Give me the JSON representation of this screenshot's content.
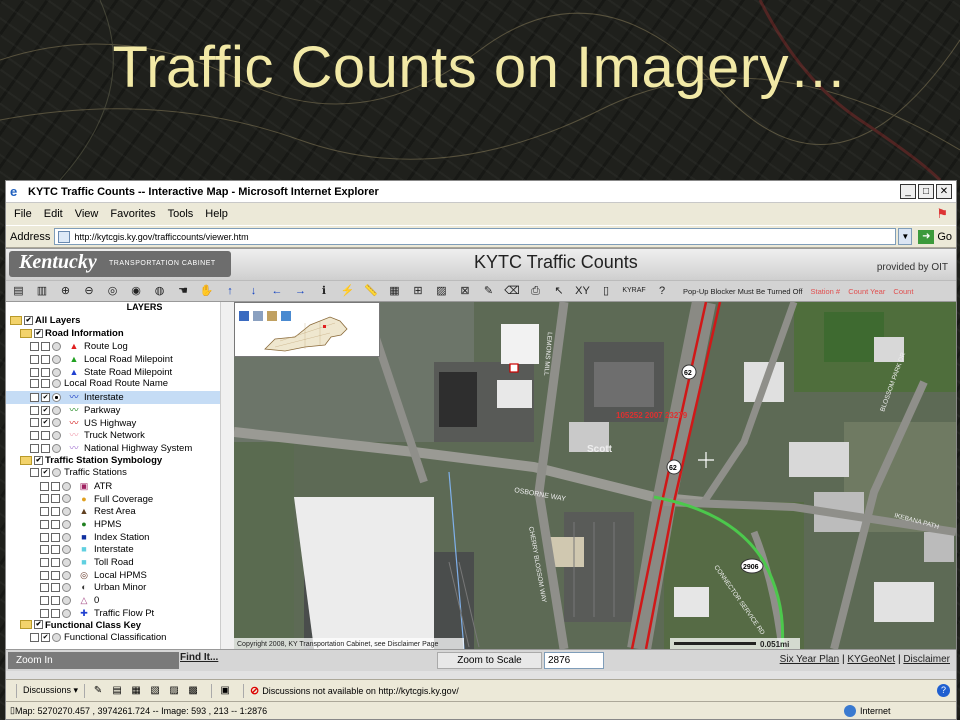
{
  "slide": {
    "title": "Traffic Counts on Imagery…"
  },
  "browser": {
    "title": "KYTC Traffic Counts -- Interactive Map - Microsoft Internet Explorer",
    "menu": [
      "File",
      "Edit",
      "View",
      "Favorites",
      "Tools",
      "Help"
    ],
    "address_label": "Address",
    "url": "http://kytcgis.ky.gov/trafficcounts/viewer.htm",
    "go_label": "Go"
  },
  "app": {
    "logo_text": "Kentucky",
    "logo_sub": "TRANSPORTATION CABINET",
    "title": "KYTC Traffic Counts",
    "provided_by": "provided by OIT",
    "popup_notice": "Pop-Up Blocker Must Be Turned Off",
    "legend_labels": [
      "Station #",
      "Count Year",
      "Count"
    ],
    "kyraf_label": "KYRAF",
    "xy_label": "XY"
  },
  "layers": {
    "header": "LAYERS",
    "rows": [
      {
        "label": "All Layers",
        "bold": true,
        "indent": 0,
        "folder": true,
        "check": "✔"
      },
      {
        "label": "Road Information",
        "bold": true,
        "indent": 1,
        "folder": true,
        "check": "✔"
      },
      {
        "label": "Route Log",
        "indent": 2,
        "sym": "▲",
        "symColor": "#e02020"
      },
      {
        "label": "Local Road Milepoint",
        "indent": 2,
        "sym": "▲",
        "symColor": "#20a020"
      },
      {
        "label": "State Road Milepoint",
        "indent": 2,
        "sym": "▲",
        "symColor": "#2040d0"
      },
      {
        "label": "Local Road Route Name",
        "indent": 2,
        "sym": ""
      },
      {
        "label": "Interstate",
        "indent": 2,
        "sym": "〰",
        "symColor": "#1030c0",
        "selected": true,
        "check": "✔"
      },
      {
        "label": "Parkway",
        "indent": 2,
        "sym": "〰",
        "symColor": "#108010",
        "check": "✔"
      },
      {
        "label": "US Highway",
        "indent": 2,
        "sym": "〰",
        "symColor": "#d01010",
        "check": "✔"
      },
      {
        "label": "Truck Network",
        "indent": 2,
        "sym": "〰",
        "symColor": "#f0a0b0"
      },
      {
        "label": "National Highway System",
        "indent": 2,
        "sym": "〰",
        "symColor": "#a070d0"
      },
      {
        "label": "Traffic Station Symbology",
        "bold": true,
        "indent": 1,
        "folder": true,
        "check": "✔"
      },
      {
        "label": "Traffic Stations",
        "indent": 2,
        "sym": "",
        "check": "✔"
      },
      {
        "label": "ATR",
        "indent": 3,
        "sym": "▣",
        "symColor": "#a02060"
      },
      {
        "label": "Full Coverage",
        "indent": 3,
        "sym": "●",
        "symColor": "#e0a020"
      },
      {
        "label": "Rest Area",
        "indent": 3,
        "sym": "▲",
        "symColor": "#604020"
      },
      {
        "label": "HPMS",
        "indent": 3,
        "sym": "●",
        "symColor": "#208020"
      },
      {
        "label": "Index Station",
        "indent": 3,
        "sym": "■",
        "symColor": "#1030a0"
      },
      {
        "label": "Interstate",
        "indent": 3,
        "sym": "■",
        "symColor": "#60d0e0"
      },
      {
        "label": "Toll Road",
        "indent": 3,
        "sym": "■",
        "symColor": "#60d0e0"
      },
      {
        "label": "Local HPMS",
        "indent": 3,
        "sym": "◎",
        "symColor": "#603020"
      },
      {
        "label": "Urban Minor",
        "indent": 3,
        "sym": "◐",
        "symColor": "#333333"
      },
      {
        "label": "0",
        "indent": 3,
        "sym": "△",
        "symColor": "#a04080"
      },
      {
        "label": "Traffic Flow Pt",
        "indent": 3,
        "sym": "✚",
        "symColor": "#2040d0"
      },
      {
        "label": "Functional Class Key",
        "bold": true,
        "indent": 1,
        "folder": true,
        "check": "✔"
      },
      {
        "label": "Functional Classification",
        "indent": 2,
        "sym": "",
        "check": "✔"
      }
    ]
  },
  "map": {
    "station_label": "105252 2007 23279",
    "street_osborne": "OSBORNE WAY",
    "street_scott": "Scott",
    "street_commerce": "CONNECTOR SERVICE RD",
    "street_cherry": "CHERRY BLOSSOM WAY",
    "street_lemons": "LEMONS MILL",
    "street_ikebana": "IKEBANA PATH",
    "street_blossom": "BLOSSOM PARK DR",
    "shield_62": "62",
    "shield_2906": "2906",
    "copyright": "Copyright 2008, KY Transportation Cabinet, see Disclaimer Page",
    "scale_text": "0.051mi"
  },
  "footer": {
    "zoom_in": "Zoom In",
    "find_it": "Find It...",
    "zoom_to_scale": "Zoom to Scale",
    "scale_value": "2876",
    "links": [
      "Six Year Plan",
      "KYGeoNet",
      "Disclaimer"
    ]
  },
  "statusbar": {
    "discussions": "Discussions ▾",
    "not_available": "Discussions not available on http://kytcgis.ky.gov/",
    "map_status": "Map: 5270270.457 , 3974261.724 -- Image: 593 , 213 -- 1:2876",
    "zone": "Internet"
  }
}
